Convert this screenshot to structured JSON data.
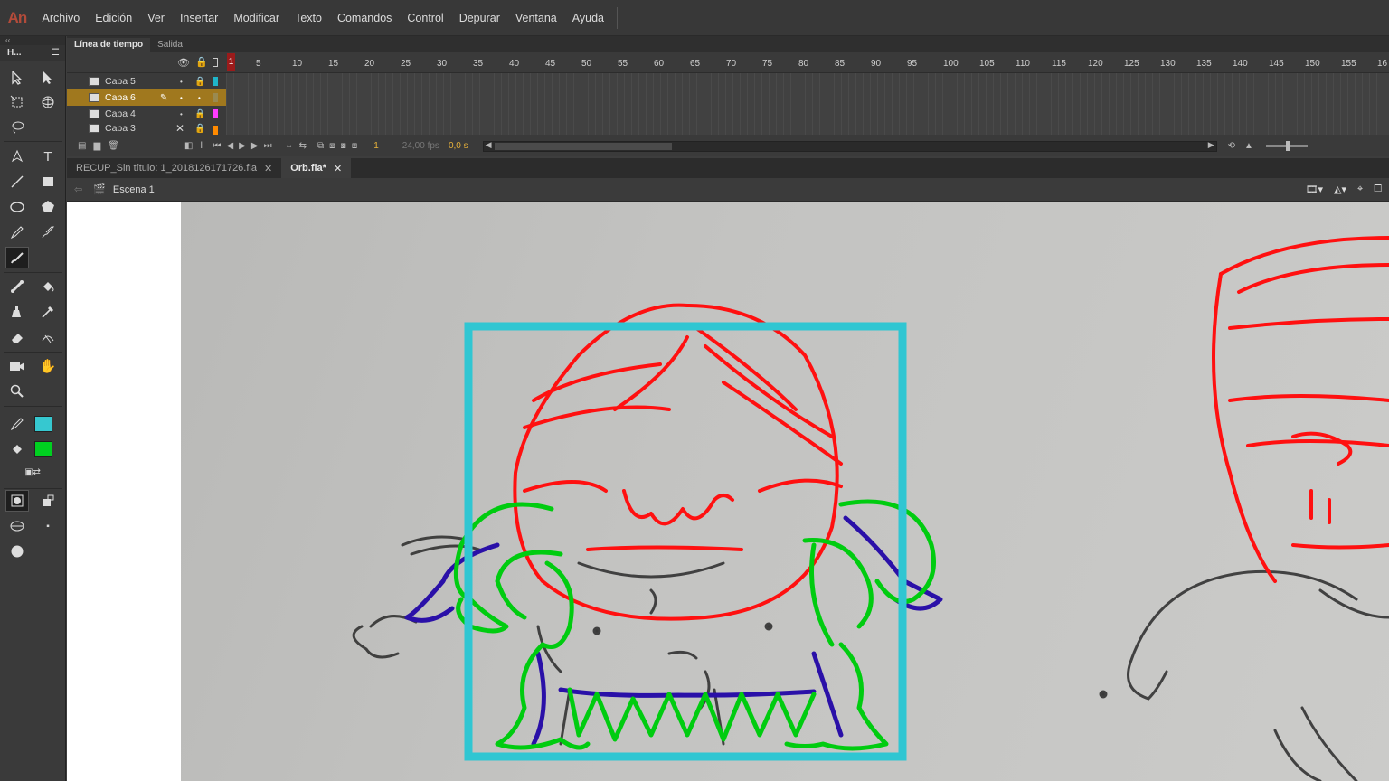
{
  "app": {
    "logo": "An"
  },
  "menu": [
    "Archivo",
    "Edición",
    "Ver",
    "Insertar",
    "Modificar",
    "Texto",
    "Comandos",
    "Control",
    "Depurar",
    "Ventana",
    "Ayuda"
  ],
  "toolbar": {
    "title": "H...",
    "stroke_color": "#36c8d0",
    "fill_color": "#00d020"
  },
  "timeline": {
    "tabs": [
      "Línea de tiempo",
      "Salida"
    ],
    "ticks": [
      "1",
      "5",
      "10",
      "15",
      "20",
      "25",
      "30",
      "35",
      "40",
      "45",
      "50",
      "55",
      "60",
      "65",
      "70",
      "75",
      "80",
      "85",
      "90",
      "95",
      "100",
      "105",
      "110",
      "115",
      "120",
      "125",
      "130",
      "135",
      "140",
      "145",
      "150",
      "155",
      "16"
    ],
    "layers": [
      {
        "name": "Capa 5",
        "color": "#1fb5c9"
      },
      {
        "name": "Capa 6",
        "color": "#9a8a50"
      },
      {
        "name": "Capa 4",
        "color": "#ff3cff"
      },
      {
        "name": "Capa 3",
        "color": "#ff8a00"
      }
    ],
    "current_frame": "1",
    "fps": "24,00 fps",
    "time": "0,0 s"
  },
  "documents": [
    {
      "name": "RECUP_Sin título: 1_2018126171726.fla"
    },
    {
      "name": "Orb.fla*"
    }
  ],
  "scene": {
    "name": "Escena 1"
  }
}
